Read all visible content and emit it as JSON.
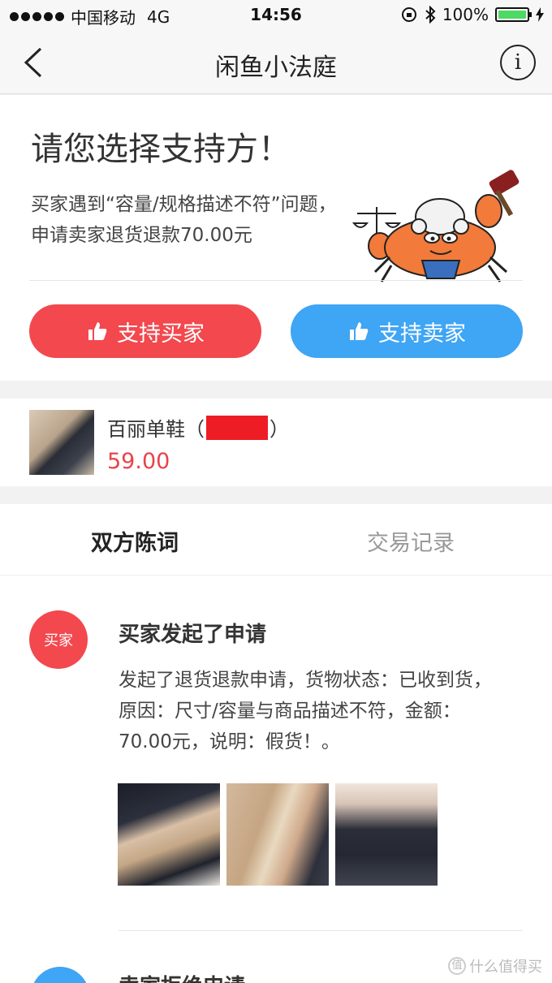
{
  "status_bar": {
    "carrier": "中国移动",
    "network": "4G",
    "time": "14:56",
    "battery": "100%",
    "battery_level": 1.0
  },
  "nav": {
    "title": "闲鱼小法庭",
    "back_icon": "chevron-left-icon",
    "info_icon": "info-icon"
  },
  "prompt": {
    "heading": "请您选择支持方！",
    "description": "买家遇到“容量/规格描述不符”问题，申请卖家退货退款70.00元",
    "support_buyer_label": "支持买家",
    "support_seller_label": "支持卖家",
    "colors": {
      "buyer": "#f2484e",
      "seller": "#3fa5f5"
    }
  },
  "product": {
    "name_prefix": "百丽单鞋（",
    "name_suffix": "）",
    "price": "59.00",
    "price_color": "#e8434a"
  },
  "tabs": {
    "active": "双方陈词",
    "inactive": "交易记录"
  },
  "statements": [
    {
      "avatar": "买家",
      "title": "买家发起了申请",
      "body": "发起了退货退款申请，货物状态：已收到货，原因：尺寸/容量与商品描述不符，金额：70.00元，说明：假货！。"
    },
    {
      "title": "卖家拒绝申请"
    }
  ],
  "watermark": "什么值得买"
}
